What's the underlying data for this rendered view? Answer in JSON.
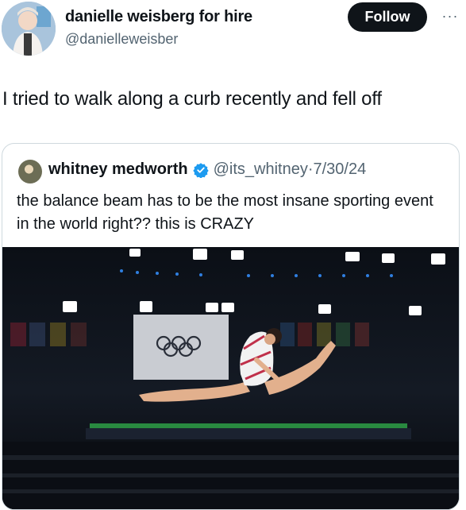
{
  "author": {
    "display_name": "danielle weisberg for hire",
    "handle": "@danielleweisber",
    "avatar_icon": "profile-photo"
  },
  "actions": {
    "follow_label": "Follow",
    "more_label": "···"
  },
  "post": {
    "text": "I tried to walk along a curb recently and fell off"
  },
  "quoted": {
    "display_name": "whitney medworth",
    "verified_icon": "verified-badge-icon",
    "handle": "@its_whitney",
    "separator": "·",
    "date": "7/30/24",
    "text": "the balance beam has to be the most insane sporting event in the world right?? this is CRAZY",
    "media_description_icon": "photo"
  },
  "colors": {
    "text": "#0f1419",
    "secondary": "#536471",
    "verified": "#1d9bf0",
    "border": "#cfd9de"
  }
}
